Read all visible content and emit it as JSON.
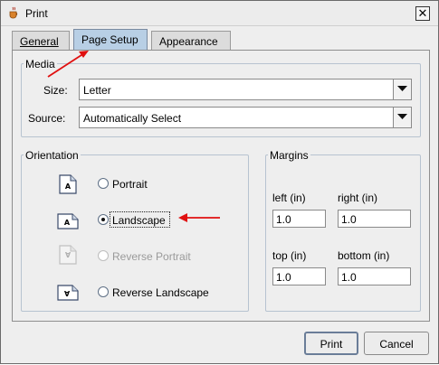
{
  "window": {
    "title": "Print"
  },
  "tabs": [
    {
      "label": "General"
    },
    {
      "label": "Page Setup"
    },
    {
      "label": "Appearance"
    }
  ],
  "media": {
    "group_title": "Media",
    "size_label": "Size:",
    "size_value": "Letter",
    "source_label": "Source:",
    "source_value": "Automatically Select"
  },
  "orientation": {
    "group_title": "Orientation",
    "options": [
      {
        "label": "Portrait",
        "selected": false,
        "enabled": true
      },
      {
        "label": "Landscape",
        "selected": true,
        "enabled": true
      },
      {
        "label": "Reverse Portrait",
        "selected": false,
        "enabled": false
      },
      {
        "label": "Reverse Landscape",
        "selected": false,
        "enabled": true
      }
    ]
  },
  "margins": {
    "group_title": "Margins",
    "left_label": "left (in)",
    "left_value": "1.0",
    "right_label": "right (in)",
    "right_value": "1.0",
    "top_label": "top (in)",
    "top_value": "1.0",
    "bottom_label": "bottom (in)",
    "bottom_value": "1.0"
  },
  "buttons": {
    "print": "Print",
    "cancel": "Cancel"
  },
  "colors": {
    "annotation_arrow": "#e01010",
    "active_tab": "#b8cfe5",
    "group_border": "#b7c3d0"
  },
  "icons": [
    "java-cup-icon",
    "close-icon",
    "chevron-down-icon",
    "page-portrait-icon",
    "page-landscape-icon",
    "page-reverse-portrait-icon",
    "page-reverse-landscape-icon"
  ]
}
